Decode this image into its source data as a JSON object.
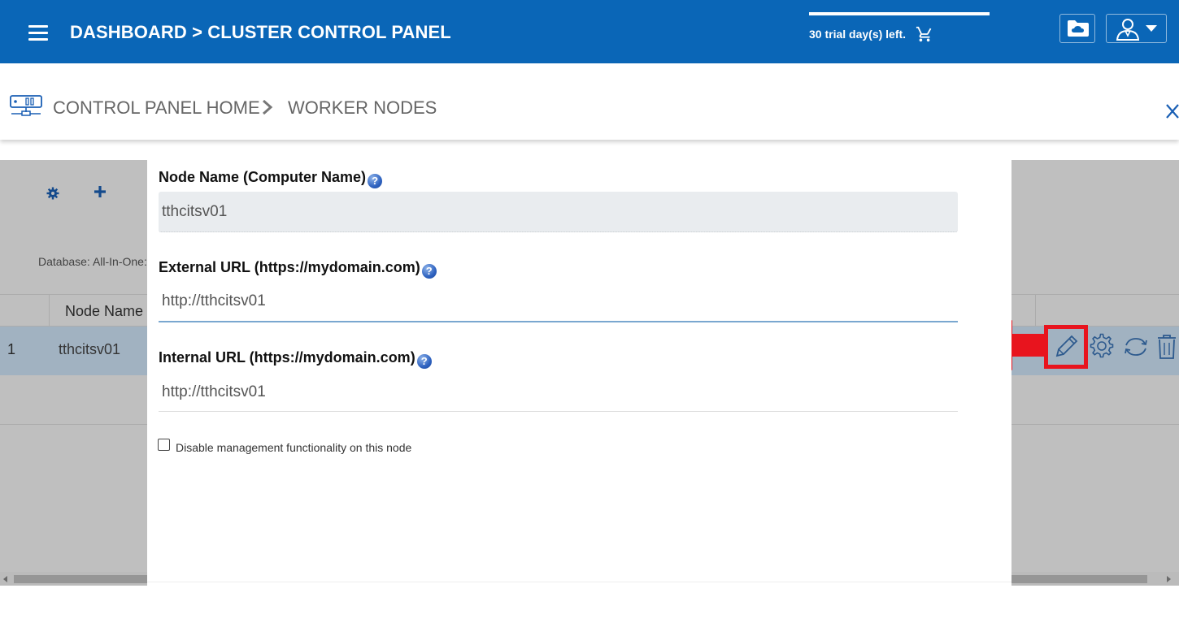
{
  "topbar": {
    "title": "DASHBOARD > CLUSTER CONTROL PANEL",
    "trial_text": "30 trial day(s) left.",
    "brand_color": "#0a66b7"
  },
  "breadcrumb": {
    "home": "CONTROL PANEL HOME",
    "current": "WORKER NODES"
  },
  "background": {
    "database_label": "Database: All-In-One:",
    "table_header_name": "Node Name",
    "rows": [
      {
        "index": "1",
        "name": "tthcitsv01"
      }
    ]
  },
  "modal": {
    "node_name_label": "Node Name (Computer Name)",
    "node_name_value": "tthcitsv01",
    "external_url_label": "External URL (https://mydomain.com)",
    "external_url_value": "http://tthcitsv01",
    "internal_url_label": "Internal URL (https://mydomain.com)",
    "internal_url_value": "http://tthcitsv01",
    "disable_checkbox_label": "Disable management functionality on this node",
    "help_glyph": "?"
  },
  "annotation": {
    "highlight_color": "#e8141e",
    "points_to": "edit-icon"
  }
}
